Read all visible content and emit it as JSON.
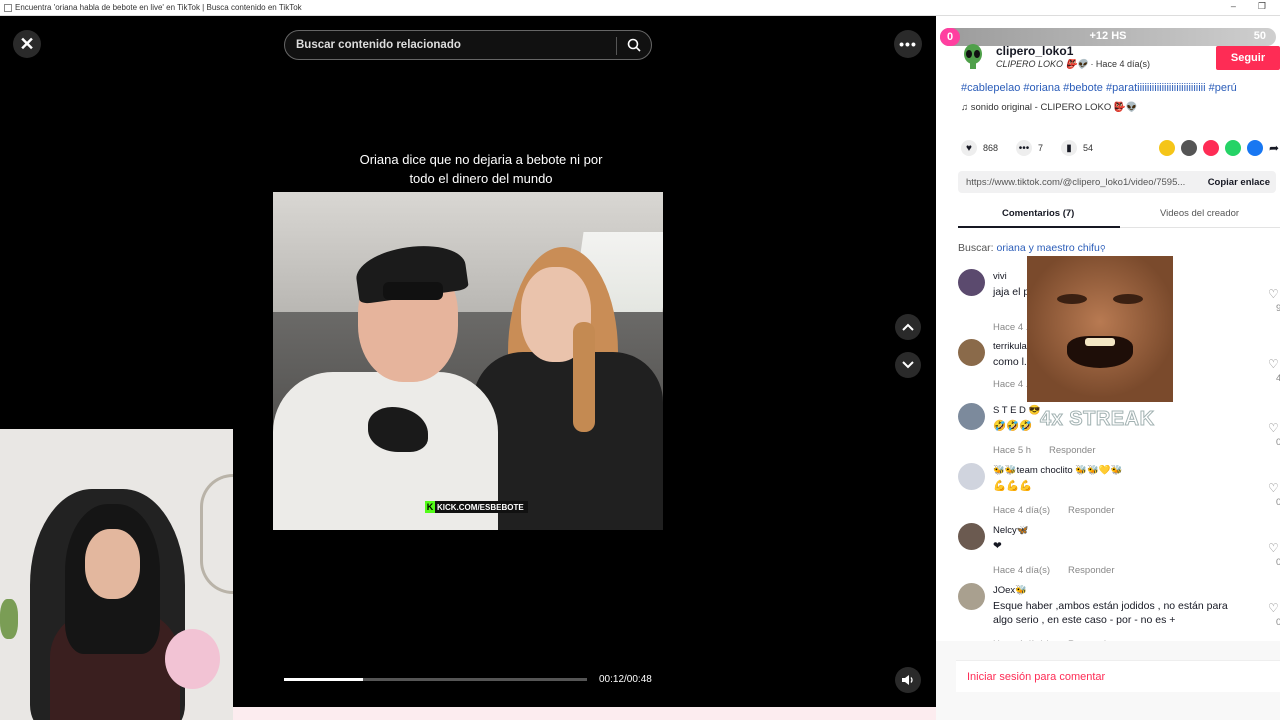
{
  "window": {
    "title": "Encuentra 'oriana habla de bebote en live' en TikTok | Busca contenido en TikTok",
    "minimize": "–",
    "restore": "❐"
  },
  "player": {
    "search_placeholder": "Buscar contenido relacionado",
    "caption_line1": "Oriana dice que no dejaria a bebote ni por",
    "caption_line2": "todo el dinero del mundo",
    "kick_tag": "KICK.COM/ESBEBOTE",
    "progress_fraction": 0.26,
    "time": "00:12/00:48"
  },
  "overlay": {
    "streak_left": "0",
    "streak_mid": "+12 HS",
    "streak_right": "50",
    "streak_text": "4x STREAK"
  },
  "post": {
    "username": "clipero_loko1",
    "display_name": "CLIPERO LOKO 👺👽",
    "posted": " · Hace 4 día(s)",
    "follow_label": "Seguir",
    "hashtags": "#cablepelao #oriana #bebote #paratiiiiiiiiiiiiiiiiiiiiiiiiiiii #perú",
    "sound": "sonido original - CLIPERO LOKO 👺👽",
    "likes": "868",
    "comments": "7",
    "saves": "54",
    "link": "https://www.tiktok.com/@clipero_loko1/video/7595...",
    "copy_label": "Copiar enlace",
    "tab_comments": "Comentarios (7)",
    "tab_videos": "Videos del creador",
    "search_prefix": "Buscar: ",
    "search_term": "oriana y maestro chifu",
    "login_label": "Iniciar sesión para comentar"
  },
  "comment_list": [
    {
      "name": "vivi",
      "text": "jaja el p... ...tidad de dinero en su r...",
      "time": "Hace 4 ...",
      "reply": "",
      "likes": "9",
      "color": "#5b4a6e"
    },
    {
      "name": "terrikula...",
      "text": "como l...",
      "time": "Hace 4 ...",
      "reply": "",
      "likes": "4",
      "color": "#8a6a4a"
    },
    {
      "name": "S T E D 😎",
      "text": "🤣🤣🤣",
      "time": "Hace 5 h",
      "reply": "Responder",
      "likes": "0",
      "color": "#7c8a9c"
    },
    {
      "name": "🐝🐝team choclito 🐝🐝💛🐝",
      "text": "💪💪💪",
      "time": "Hace 4 día(s)",
      "reply": "Responder",
      "likes": "0",
      "color": "#d0d4de"
    },
    {
      "name": "Nelcy🦋",
      "text": "❤",
      "time": "Hace 4 día(s)",
      "reply": "Responder",
      "likes": "0",
      "color": "#6b5a50"
    },
    {
      "name": "JOex🐝",
      "text": "Esque haber ,ambos están jodidos , no están para algo serio , en este caso - por - no es +",
      "time": "Hace 4 día(s)",
      "reply": "Responder",
      "likes": "0",
      "color": "#a9a08f"
    }
  ]
}
